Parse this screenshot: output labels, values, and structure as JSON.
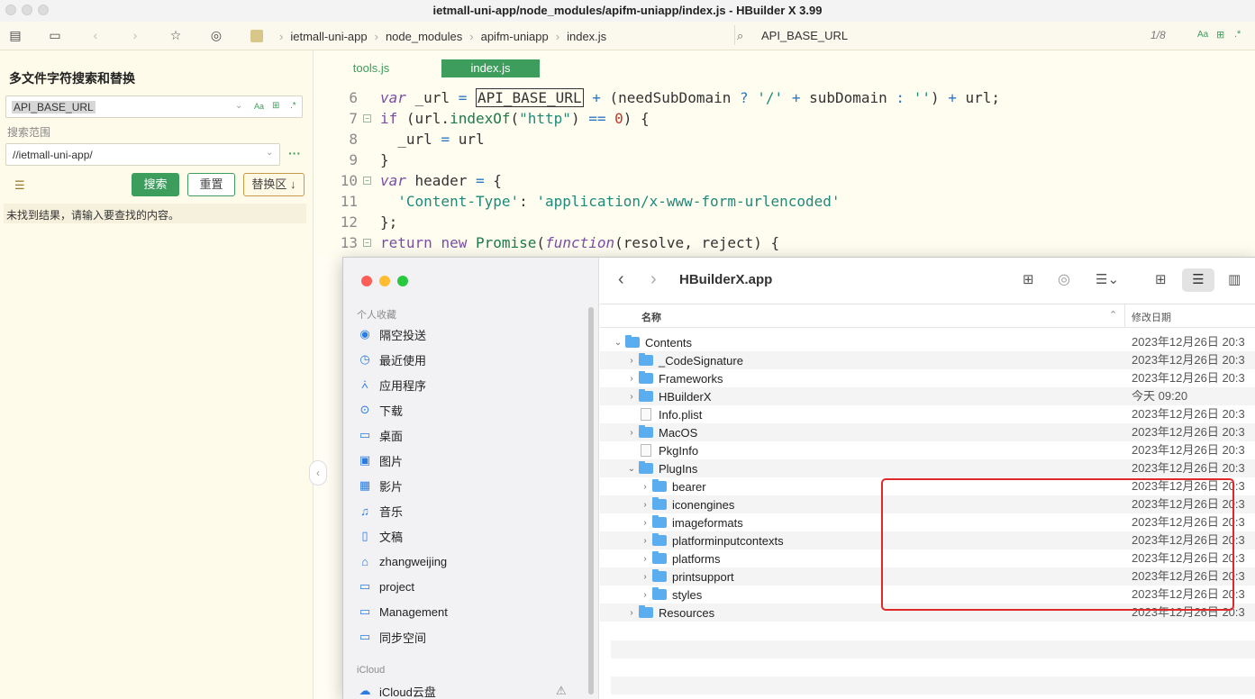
{
  "window": {
    "title": "ietmall-uni-app/node_modules/apifm-uniapp/index.js - HBuilder X 3.99"
  },
  "toolbar": {
    "breadcrumbs": [
      "ietmall-uni-app",
      "node_modules",
      "apifm-uniapp",
      "index.js"
    ],
    "search_text": "API_BASE_URL",
    "match_count": "1/8",
    "aa_label": "Aa"
  },
  "search_panel": {
    "title": "多文件字符搜索和替换",
    "query": "API_BASE_URL",
    "scope_label": "搜索范围",
    "scope_value": "//ietmall-uni-app/",
    "search_button": "搜索",
    "reset_button": "重置",
    "replace_button": "替换区",
    "status": "未找到结果，请输入要查找的内容。",
    "more": "···"
  },
  "editor": {
    "tabs": [
      "tools.js",
      "index.js"
    ],
    "active_tab": "index.js",
    "lines": [
      {
        "n": "6",
        "fold": false
      },
      {
        "n": "7",
        "fold": true
      },
      {
        "n": "8",
        "fold": false
      },
      {
        "n": "9",
        "fold": false
      },
      {
        "n": "10",
        "fold": true
      },
      {
        "n": "11",
        "fold": false
      },
      {
        "n": "12",
        "fold": false
      },
      {
        "n": "13",
        "fold": true
      }
    ]
  },
  "finder": {
    "location": "HBuilderX.app",
    "sidebar_favorites_header": "个人收藏",
    "sidebar_items": [
      {
        "label": "隔空投送",
        "icon": "airdrop-icon"
      },
      {
        "label": "最近使用",
        "icon": "clock-icon"
      },
      {
        "label": "应用程序",
        "icon": "applications-icon"
      },
      {
        "label": "下载",
        "icon": "download-icon"
      },
      {
        "label": "桌面",
        "icon": "desktop-icon"
      },
      {
        "label": "图片",
        "icon": "photo-icon"
      },
      {
        "label": "影片",
        "icon": "film-icon"
      },
      {
        "label": "音乐",
        "icon": "music-icon"
      },
      {
        "label": "文稿",
        "icon": "document-icon"
      },
      {
        "label": "zhangweijing",
        "icon": "home-icon"
      },
      {
        "label": "project",
        "icon": "folder-icon"
      },
      {
        "label": "Management",
        "icon": "folder-icon"
      },
      {
        "label": "同步空间",
        "icon": "folder-icon"
      }
    ],
    "sidebar_icloud_header": "iCloud",
    "icloud_item": "iCloud云盘",
    "col_name": "名称",
    "col_date": "修改日期",
    "rows": [
      {
        "name": "Contents",
        "level": 0,
        "type": "folder",
        "expanded": true,
        "date": "2023年12月26日 20:3"
      },
      {
        "name": "_CodeSignature",
        "level": 1,
        "type": "folder",
        "expanded": false,
        "date": "2023年12月26日 20:3"
      },
      {
        "name": "Frameworks",
        "level": 1,
        "type": "folder",
        "expanded": false,
        "date": "2023年12月26日 20:3"
      },
      {
        "name": "HBuilderX",
        "level": 1,
        "type": "folder",
        "expanded": false,
        "date": "今天 09:20"
      },
      {
        "name": "Info.plist",
        "level": 1,
        "type": "file",
        "expanded": false,
        "date": "2023年12月26日 20:3"
      },
      {
        "name": "MacOS",
        "level": 1,
        "type": "folder",
        "expanded": false,
        "date": "2023年12月26日 20:3"
      },
      {
        "name": "PkgInfo",
        "level": 1,
        "type": "file",
        "expanded": false,
        "date": "2023年12月26日 20:3"
      },
      {
        "name": "PlugIns",
        "level": 1,
        "type": "folder",
        "expanded": true,
        "date": "2023年12月26日 20:3"
      },
      {
        "name": "bearer",
        "level": 2,
        "type": "folder",
        "expanded": false,
        "date": "2023年12月26日 20:3"
      },
      {
        "name": "iconengines",
        "level": 2,
        "type": "folder",
        "expanded": false,
        "date": "2023年12月26日 20:3"
      },
      {
        "name": "imageformats",
        "level": 2,
        "type": "folder",
        "expanded": false,
        "date": "2023年12月26日 20:3"
      },
      {
        "name": "platforminputcontexts",
        "level": 2,
        "type": "folder",
        "expanded": false,
        "date": "2023年12月26日 20:3"
      },
      {
        "name": "platforms",
        "level": 2,
        "type": "folder",
        "expanded": false,
        "date": "2023年12月26日 20:3"
      },
      {
        "name": "printsupport",
        "level": 2,
        "type": "folder",
        "expanded": false,
        "date": "2023年12月26日 20:3"
      },
      {
        "name": "styles",
        "level": 2,
        "type": "folder",
        "expanded": false,
        "date": "2023年12月26日 20:3"
      },
      {
        "name": "Resources",
        "level": 1,
        "type": "folder",
        "expanded": false,
        "date": "2023年12月26日 20:3"
      }
    ]
  },
  "colors": {
    "accent_green": "#3c9d5c",
    "highlight_red": "#e02a2a",
    "folder_blue": "#5aaef0"
  }
}
